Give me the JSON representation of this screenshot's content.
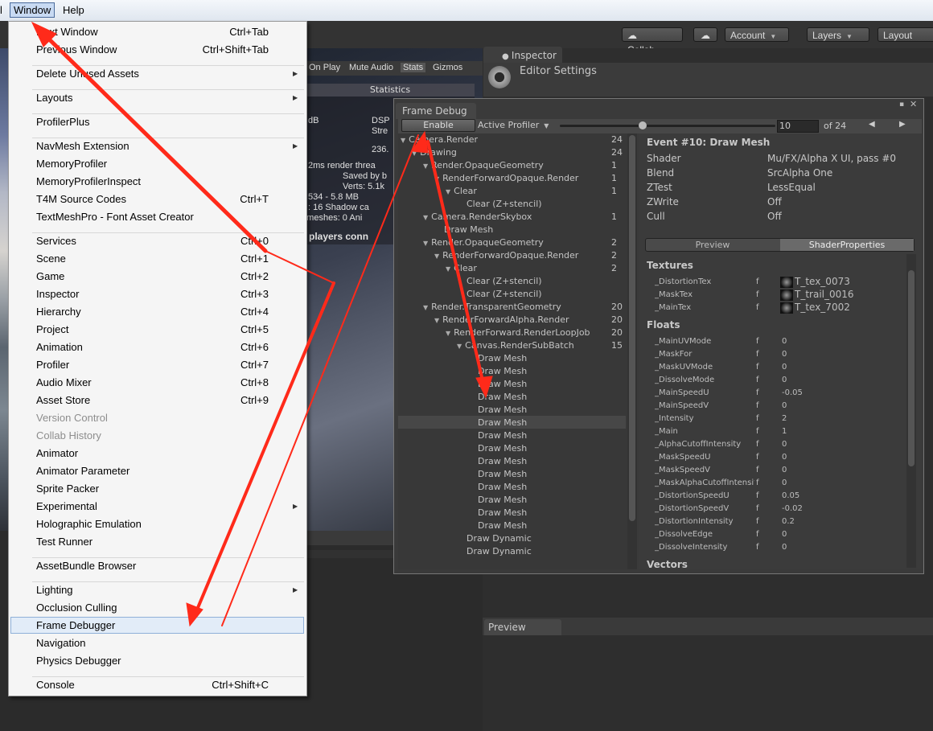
{
  "menubar": {
    "partial_left": "l",
    "window": "Window",
    "help": "Help"
  },
  "toolbar": {
    "collab": "Collab",
    "account": "Account",
    "layers": "Layers",
    "layout": "Layout"
  },
  "game_tabs": {
    "on_play": "On Play",
    "mute_audio": "Mute Audio",
    "stats": "Stats",
    "gizmos": "Gizmos"
  },
  "stats": {
    "title": "Statistics",
    "lines": [
      "dB",
      "DSP",
      "Stre",
      "236.",
      "2ms  render threa",
      "Saved by b",
      "Verts: 5.1k",
      "534 - 5.8 MB",
      ": 16    Shadow ca",
      "d meshes: 0  Ani",
      "players conn"
    ]
  },
  "inspector": {
    "tab": "Inspector",
    "title": "Editor Settings",
    "preview": "Preview"
  },
  "frame_debug": {
    "tab": "Frame Debug",
    "enable": "Enable",
    "profiler": "Active Profiler",
    "event_index": "10",
    "of_total": "of 24",
    "tree": [
      {
        "label": "Camera.Render",
        "count": "24"
      },
      {
        "label": "Drawing",
        "count": "24"
      },
      {
        "label": "Render.OpaqueGeometry",
        "count": "1"
      },
      {
        "label": "RenderForwardOpaque.Render",
        "count": "1"
      },
      {
        "label": "Clear",
        "count": "1"
      },
      {
        "label": "Clear (Z+stencil)",
        "count": ""
      },
      {
        "label": "Camera.RenderSkybox",
        "count": "1"
      },
      {
        "label": "Draw Mesh",
        "count": ""
      },
      {
        "label": "Render.OpaqueGeometry",
        "count": "2"
      },
      {
        "label": "RenderForwardOpaque.Render",
        "count": "2"
      },
      {
        "label": "Clear",
        "count": "2"
      },
      {
        "label": "Clear (Z+stencil)",
        "count": ""
      },
      {
        "label": "Clear (Z+stencil)",
        "count": ""
      },
      {
        "label": "Render.TransparentGeometry",
        "count": "20"
      },
      {
        "label": "RenderForwardAlpha.Render",
        "count": "20"
      },
      {
        "label": "RenderForward.RenderLoopJob",
        "count": "20"
      },
      {
        "label": "Canvas.RenderSubBatch",
        "count": "15"
      },
      {
        "label": "Draw Mesh",
        "count": ""
      },
      {
        "label": "Draw Mesh",
        "count": ""
      },
      {
        "label": "Draw Mesh",
        "count": ""
      },
      {
        "label": "Draw Mesh",
        "count": ""
      },
      {
        "label": "Draw Mesh",
        "count": ""
      },
      {
        "label": "Draw Mesh",
        "count": ""
      },
      {
        "label": "Draw Mesh",
        "count": ""
      },
      {
        "label": "Draw Mesh",
        "count": ""
      },
      {
        "label": "Draw Mesh",
        "count": ""
      },
      {
        "label": "Draw Mesh",
        "count": ""
      },
      {
        "label": "Draw Mesh",
        "count": ""
      },
      {
        "label": "Draw Mesh",
        "count": ""
      },
      {
        "label": "Draw Mesh",
        "count": ""
      },
      {
        "label": "Draw Mesh",
        "count": ""
      },
      {
        "label": "Draw Dynamic",
        "count": ""
      },
      {
        "label": "Draw Dynamic",
        "count": ""
      }
    ],
    "event": {
      "title": "Event #10: Draw Mesh",
      "props": [
        {
          "k": "Shader",
          "v": "Mu/FX/Alpha X UI, pass #0"
        },
        {
          "k": "Blend",
          "v": "SrcAlpha One"
        },
        {
          "k": "ZTest",
          "v": "LessEqual"
        },
        {
          "k": "ZWrite",
          "v": "Off"
        },
        {
          "k": "Cull",
          "v": "Off"
        }
      ],
      "tab_preview": "Preview",
      "tab_shader": "ShaderProperties",
      "textures_title": "Textures",
      "textures": [
        {
          "name": "_DistortionTex",
          "type": "f",
          "value": "T_tex_0073"
        },
        {
          "name": "_MaskTex",
          "type": "f",
          "value": "T_trail_0016"
        },
        {
          "name": "_MainTex",
          "type": "f",
          "value": "T_tex_7002"
        }
      ],
      "floats_title": "Floats",
      "floats": [
        {
          "name": "_MainUVMode",
          "type": "f",
          "value": "0"
        },
        {
          "name": "_MaskFor",
          "type": "f",
          "value": "0"
        },
        {
          "name": "_MaskUVMode",
          "type": "f",
          "value": "0"
        },
        {
          "name": "_DissolveMode",
          "type": "f",
          "value": "0"
        },
        {
          "name": "_MainSpeedU",
          "type": "f",
          "value": "-0.05"
        },
        {
          "name": "_MainSpeedV",
          "type": "f",
          "value": "0"
        },
        {
          "name": "_Intensity",
          "type": "f",
          "value": "2"
        },
        {
          "name": "_Main",
          "type": "f",
          "value": "1"
        },
        {
          "name": "_AlphaCutoffIntensity",
          "type": "f",
          "value": "0"
        },
        {
          "name": "_MaskSpeedU",
          "type": "f",
          "value": "0"
        },
        {
          "name": "_MaskSpeedV",
          "type": "f",
          "value": "0"
        },
        {
          "name": "_MaskAlphaCutoffIntensity",
          "type": "f",
          "value": "0"
        },
        {
          "name": "_DistortionSpeedU",
          "type": "f",
          "value": "0.05"
        },
        {
          "name": "_DistortionSpeedV",
          "type": "f",
          "value": "-0.02"
        },
        {
          "name": "_DistortionIntensity",
          "type": "f",
          "value": "0.2"
        },
        {
          "name": "_DissolveEdge",
          "type": "f",
          "value": "0"
        },
        {
          "name": "_DissolveIntensity",
          "type": "f",
          "value": "0"
        }
      ],
      "vectors_title": "Vectors"
    }
  },
  "menu": {
    "items": [
      {
        "label": "Next Window",
        "shortcut": "Ctrl+Tab"
      },
      {
        "label": "Previous Window",
        "shortcut": "Ctrl+Shift+Tab"
      },
      {
        "label": "Delete Unused Assets",
        "shortcut": "",
        "submenu": true
      },
      {
        "label": "Layouts",
        "shortcut": "",
        "submenu": true
      },
      {
        "label": "ProfilerPlus",
        "shortcut": ""
      },
      {
        "label": "NavMesh Extension",
        "shortcut": "",
        "submenu": true
      },
      {
        "label": "MemoryProfiler",
        "shortcut": ""
      },
      {
        "label": "MemoryProfilerInspect",
        "shortcut": ""
      },
      {
        "label": "T4M Source Codes",
        "shortcut": "Ctrl+T"
      },
      {
        "label": "TextMeshPro - Font Asset Creator",
        "shortcut": ""
      },
      {
        "label": "Services",
        "shortcut": "Ctrl+0"
      },
      {
        "label": "Scene",
        "shortcut": "Ctrl+1"
      },
      {
        "label": "Game",
        "shortcut": "Ctrl+2"
      },
      {
        "label": "Inspector",
        "shortcut": "Ctrl+3"
      },
      {
        "label": "Hierarchy",
        "shortcut": "Ctrl+4"
      },
      {
        "label": "Project",
        "shortcut": "Ctrl+5"
      },
      {
        "label": "Animation",
        "shortcut": "Ctrl+6"
      },
      {
        "label": "Profiler",
        "shortcut": "Ctrl+7"
      },
      {
        "label": "Audio Mixer",
        "shortcut": "Ctrl+8"
      },
      {
        "label": "Asset Store",
        "shortcut": "Ctrl+9"
      },
      {
        "label": "Version Control",
        "shortcut": "",
        "disabled": true
      },
      {
        "label": "Collab History",
        "shortcut": "",
        "disabled": true
      },
      {
        "label": "Animator",
        "shortcut": ""
      },
      {
        "label": "Animator Parameter",
        "shortcut": ""
      },
      {
        "label": "Sprite Packer",
        "shortcut": ""
      },
      {
        "label": "Experimental",
        "shortcut": "",
        "submenu": true
      },
      {
        "label": "Holographic Emulation",
        "shortcut": ""
      },
      {
        "label": "Test Runner",
        "shortcut": ""
      },
      {
        "label": "AssetBundle Browser",
        "shortcut": ""
      },
      {
        "label": "Lighting",
        "shortcut": "",
        "submenu": true
      },
      {
        "label": "Occlusion Culling",
        "shortcut": ""
      },
      {
        "label": "Frame Debugger",
        "shortcut": "",
        "highlighted": true
      },
      {
        "label": "Navigation",
        "shortcut": ""
      },
      {
        "label": "Physics Debugger",
        "shortcut": ""
      },
      {
        "label": "Console",
        "shortcut": "Ctrl+Shift+C"
      }
    ]
  },
  "colors": {
    "annotation": "#ff2a1a",
    "menu_highlight": "#e2ecf8"
  }
}
